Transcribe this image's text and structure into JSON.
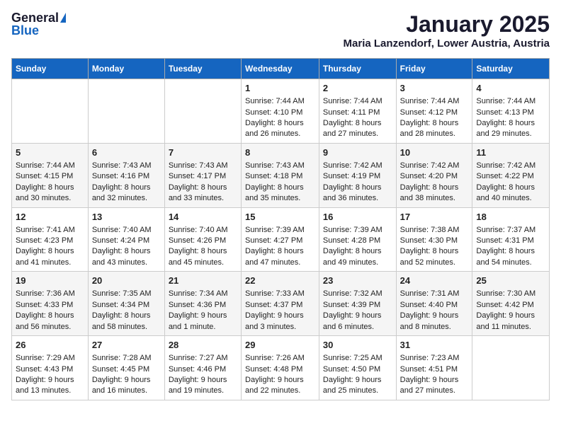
{
  "logo": {
    "general": "General",
    "blue": "Blue"
  },
  "title": "January 2025",
  "subtitle": "Maria Lanzendorf, Lower Austria, Austria",
  "headers": [
    "Sunday",
    "Monday",
    "Tuesday",
    "Wednesday",
    "Thursday",
    "Friday",
    "Saturday"
  ],
  "weeks": [
    [
      {
        "day": "",
        "data": ""
      },
      {
        "day": "",
        "data": ""
      },
      {
        "day": "",
        "data": ""
      },
      {
        "day": "1",
        "data": "Sunrise: 7:44 AM\nSunset: 4:10 PM\nDaylight: 8 hours and 26 minutes."
      },
      {
        "day": "2",
        "data": "Sunrise: 7:44 AM\nSunset: 4:11 PM\nDaylight: 8 hours and 27 minutes."
      },
      {
        "day": "3",
        "data": "Sunrise: 7:44 AM\nSunset: 4:12 PM\nDaylight: 8 hours and 28 minutes."
      },
      {
        "day": "4",
        "data": "Sunrise: 7:44 AM\nSunset: 4:13 PM\nDaylight: 8 hours and 29 minutes."
      }
    ],
    [
      {
        "day": "5",
        "data": "Sunrise: 7:44 AM\nSunset: 4:15 PM\nDaylight: 8 hours and 30 minutes."
      },
      {
        "day": "6",
        "data": "Sunrise: 7:43 AM\nSunset: 4:16 PM\nDaylight: 8 hours and 32 minutes."
      },
      {
        "day": "7",
        "data": "Sunrise: 7:43 AM\nSunset: 4:17 PM\nDaylight: 8 hours and 33 minutes."
      },
      {
        "day": "8",
        "data": "Sunrise: 7:43 AM\nSunset: 4:18 PM\nDaylight: 8 hours and 35 minutes."
      },
      {
        "day": "9",
        "data": "Sunrise: 7:42 AM\nSunset: 4:19 PM\nDaylight: 8 hours and 36 minutes."
      },
      {
        "day": "10",
        "data": "Sunrise: 7:42 AM\nSunset: 4:20 PM\nDaylight: 8 hours and 38 minutes."
      },
      {
        "day": "11",
        "data": "Sunrise: 7:42 AM\nSunset: 4:22 PM\nDaylight: 8 hours and 40 minutes."
      }
    ],
    [
      {
        "day": "12",
        "data": "Sunrise: 7:41 AM\nSunset: 4:23 PM\nDaylight: 8 hours and 41 minutes."
      },
      {
        "day": "13",
        "data": "Sunrise: 7:40 AM\nSunset: 4:24 PM\nDaylight: 8 hours and 43 minutes."
      },
      {
        "day": "14",
        "data": "Sunrise: 7:40 AM\nSunset: 4:26 PM\nDaylight: 8 hours and 45 minutes."
      },
      {
        "day": "15",
        "data": "Sunrise: 7:39 AM\nSunset: 4:27 PM\nDaylight: 8 hours and 47 minutes."
      },
      {
        "day": "16",
        "data": "Sunrise: 7:39 AM\nSunset: 4:28 PM\nDaylight: 8 hours and 49 minutes."
      },
      {
        "day": "17",
        "data": "Sunrise: 7:38 AM\nSunset: 4:30 PM\nDaylight: 8 hours and 52 minutes."
      },
      {
        "day": "18",
        "data": "Sunrise: 7:37 AM\nSunset: 4:31 PM\nDaylight: 8 hours and 54 minutes."
      }
    ],
    [
      {
        "day": "19",
        "data": "Sunrise: 7:36 AM\nSunset: 4:33 PM\nDaylight: 8 hours and 56 minutes."
      },
      {
        "day": "20",
        "data": "Sunrise: 7:35 AM\nSunset: 4:34 PM\nDaylight: 8 hours and 58 minutes."
      },
      {
        "day": "21",
        "data": "Sunrise: 7:34 AM\nSunset: 4:36 PM\nDaylight: 9 hours and 1 minute."
      },
      {
        "day": "22",
        "data": "Sunrise: 7:33 AM\nSunset: 4:37 PM\nDaylight: 9 hours and 3 minutes."
      },
      {
        "day": "23",
        "data": "Sunrise: 7:32 AM\nSunset: 4:39 PM\nDaylight: 9 hours and 6 minutes."
      },
      {
        "day": "24",
        "data": "Sunrise: 7:31 AM\nSunset: 4:40 PM\nDaylight: 9 hours and 8 minutes."
      },
      {
        "day": "25",
        "data": "Sunrise: 7:30 AM\nSunset: 4:42 PM\nDaylight: 9 hours and 11 minutes."
      }
    ],
    [
      {
        "day": "26",
        "data": "Sunrise: 7:29 AM\nSunset: 4:43 PM\nDaylight: 9 hours and 13 minutes."
      },
      {
        "day": "27",
        "data": "Sunrise: 7:28 AM\nSunset: 4:45 PM\nDaylight: 9 hours and 16 minutes."
      },
      {
        "day": "28",
        "data": "Sunrise: 7:27 AM\nSunset: 4:46 PM\nDaylight: 9 hours and 19 minutes."
      },
      {
        "day": "29",
        "data": "Sunrise: 7:26 AM\nSunset: 4:48 PM\nDaylight: 9 hours and 22 minutes."
      },
      {
        "day": "30",
        "data": "Sunrise: 7:25 AM\nSunset: 4:50 PM\nDaylight: 9 hours and 25 minutes."
      },
      {
        "day": "31",
        "data": "Sunrise: 7:23 AM\nSunset: 4:51 PM\nDaylight: 9 hours and 27 minutes."
      },
      {
        "day": "",
        "data": ""
      }
    ]
  ]
}
